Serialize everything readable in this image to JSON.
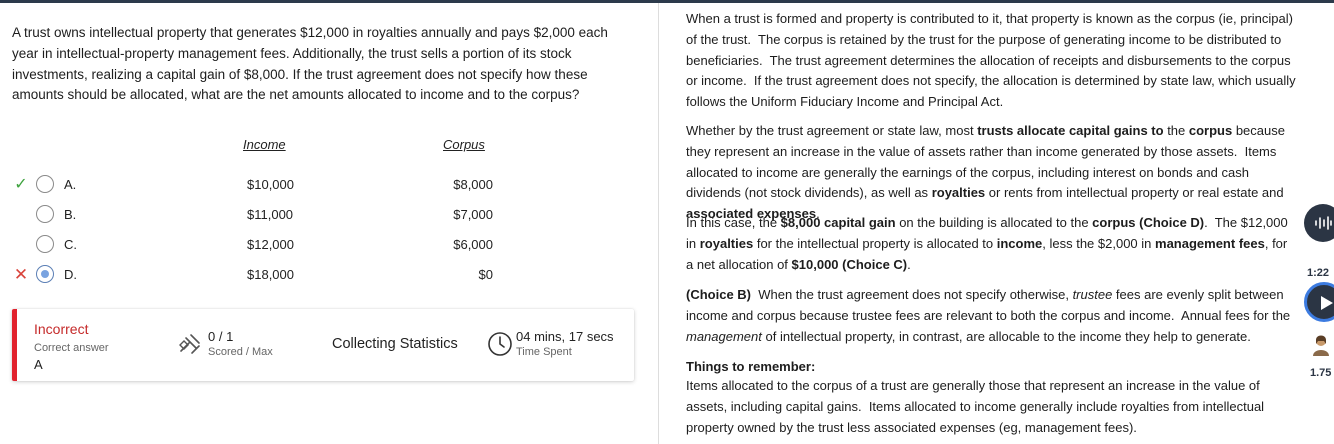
{
  "question": {
    "text": "A trust owns intellectual property that generates $12,000 in royalties annually and pays $2,000 each year in intellectual-property management fees.  Additionally, the trust sells a portion of its stock investments, realizing a capital gain of $8,000.  If the trust agreement does not specify how these amounts should be allocated, what are the net amounts allocated to income and to the corpus?"
  },
  "table": {
    "income_header": "Income",
    "corpus_header": "Corpus",
    "options": [
      {
        "letter": "A.",
        "income": "$10,000",
        "corpus": "$8,000",
        "mark": "✓",
        "selected": false
      },
      {
        "letter": "B.",
        "income": "$11,000",
        "corpus": "$7,000",
        "mark": "",
        "selected": false
      },
      {
        "letter": "C.",
        "income": "$12,000",
        "corpus": "$6,000",
        "mark": "",
        "selected": false
      },
      {
        "letter": "D.",
        "income": "$18,000",
        "corpus": "$0",
        "mark": "✕",
        "selected": true
      }
    ]
  },
  "stats": {
    "status": "Incorrect",
    "correct_answer_label": "Correct answer",
    "correct_answer": "A",
    "score": "0 / 1",
    "score_label": "Scored / Max",
    "collecting": "Collecting Statistics",
    "time": "04 mins, 17 secs",
    "time_label": "Time Spent"
  },
  "explanation": {
    "things_heading": "Things to remember:"
  },
  "controls": {
    "speed_top": "1:22",
    "speed_bottom": "1.75"
  },
  "colors": {
    "incorrect_red": "#e1222d",
    "check_green": "#3fa33f",
    "control_dark": "#2b3544",
    "play_ring": "#3c7be0"
  }
}
